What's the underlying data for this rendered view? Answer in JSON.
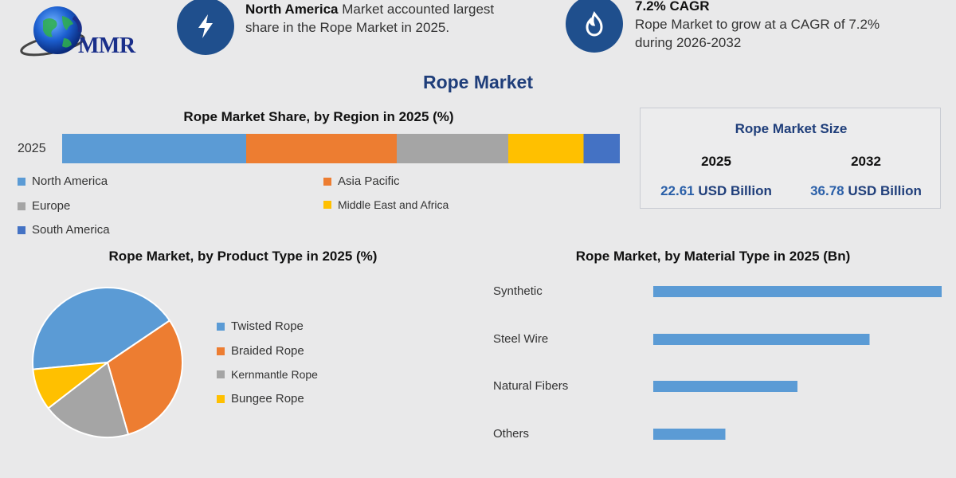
{
  "brand": {
    "logo_text": "MMR"
  },
  "header": {
    "fact1": {
      "bold": "North America",
      "rest": " Market accounted largest",
      "line2": "share in the Rope Market in 2025.",
      "icon": "lightning-icon"
    },
    "fact2": {
      "bold": "7.2% CAGR",
      "line1": "Rope Market to grow at a CAGR of 7.2%",
      "line2": "during 2026-2032",
      "icon": "flame-icon"
    }
  },
  "title": "Rope Market",
  "market_size": {
    "title": "Rope Market Size",
    "year_a": "2025",
    "value_a": "22.61",
    "unit_a": " USD Billion",
    "year_b": "2032",
    "value_b": "36.78",
    "unit_b": " USD Billion"
  },
  "colors": {
    "blue": "#5b9bd5",
    "orange": "#ed7d31",
    "gray": "#a5a5a5",
    "yellow": "#ffc000",
    "darkblue": "#4472c4",
    "icon_bg": "#1f4f8d"
  },
  "chart_data": [
    {
      "type": "bar",
      "orientation": "horizontal-stacked",
      "title": "Rope Market Share, by Region in 2025 (%)",
      "categories": [
        "2025"
      ],
      "series": [
        {
          "name": "North America",
          "values": [
            33
          ]
        },
        {
          "name": "Asia Pacific",
          "values": [
            27
          ]
        },
        {
          "name": "Europe",
          "values": [
            20
          ]
        },
        {
          "name": "Middle East and Africa",
          "values": [
            13.5
          ]
        },
        {
          "name": "South America",
          "values": [
            6.5
          ]
        }
      ],
      "legend": "bottom"
    },
    {
      "type": "pie",
      "title": "Rope Market, by Product Type in 2025 (%)",
      "categories": [
        "Twisted Rope",
        "Braided Rope",
        "Kernmantle Rope",
        "Bungee Rope"
      ],
      "values": [
        42,
        30,
        19,
        9
      ],
      "legend": "right"
    },
    {
      "type": "bar",
      "orientation": "horizontal",
      "title": "Rope Market, by Material Type in 2025 (Bn)",
      "categories": [
        "Synthetic",
        "Steel Wire",
        "Natural Fibers",
        "Others"
      ],
      "values": [
        10,
        7.5,
        5,
        2.5
      ],
      "xlim": [
        0,
        10
      ]
    }
  ]
}
